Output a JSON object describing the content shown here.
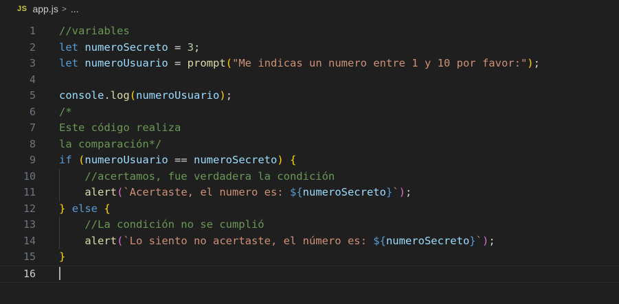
{
  "breadcrumb": {
    "language_badge": "JS",
    "file": "app.js",
    "separator": ">",
    "more": "..."
  },
  "editor": {
    "active_line": 16,
    "lines": [
      {
        "n": "1",
        "tokens": [
          {
            "t": "//variables",
            "c": "cm"
          }
        ]
      },
      {
        "n": "2",
        "tokens": [
          {
            "t": "let",
            "c": "kw"
          },
          {
            "t": " ",
            "c": "op"
          },
          {
            "t": "numeroSecreto",
            "c": "vr"
          },
          {
            "t": " = ",
            "c": "op"
          },
          {
            "t": "3",
            "c": "nm"
          },
          {
            "t": ";",
            "c": "op"
          }
        ]
      },
      {
        "n": "3",
        "tokens": [
          {
            "t": "let",
            "c": "kw"
          },
          {
            "t": " ",
            "c": "op"
          },
          {
            "t": "numeroUsuario",
            "c": "vr"
          },
          {
            "t": " = ",
            "c": "op"
          },
          {
            "t": "prompt",
            "c": "fn"
          },
          {
            "t": "(",
            "c": "b1"
          },
          {
            "t": "\"Me indicas un numero entre 1 y 10 por favor:\"",
            "c": "st"
          },
          {
            "t": ")",
            "c": "b1"
          },
          {
            "t": ";",
            "c": "op"
          }
        ]
      },
      {
        "n": "4",
        "tokens": []
      },
      {
        "n": "5",
        "tokens": [
          {
            "t": "console",
            "c": "vr"
          },
          {
            "t": ".",
            "c": "op"
          },
          {
            "t": "log",
            "c": "fn"
          },
          {
            "t": "(",
            "c": "b1"
          },
          {
            "t": "numeroUsuario",
            "c": "vr"
          },
          {
            "t": ")",
            "c": "b1"
          },
          {
            "t": ";",
            "c": "op"
          }
        ]
      },
      {
        "n": "6",
        "tokens": [
          {
            "t": "/*",
            "c": "cm"
          }
        ]
      },
      {
        "n": "7",
        "tokens": [
          {
            "t": "Este código realiza",
            "c": "cm"
          }
        ]
      },
      {
        "n": "8",
        "tokens": [
          {
            "t": "la comparación*/",
            "c": "cm"
          }
        ]
      },
      {
        "n": "9",
        "tokens": [
          {
            "t": "if",
            "c": "kw"
          },
          {
            "t": " ",
            "c": "op"
          },
          {
            "t": "(",
            "c": "b1"
          },
          {
            "t": "numeroUsuario",
            "c": "vr"
          },
          {
            "t": " == ",
            "c": "op"
          },
          {
            "t": "numeroSecreto",
            "c": "vr"
          },
          {
            "t": ")",
            "c": "b1"
          },
          {
            "t": " ",
            "c": "op"
          },
          {
            "t": "{",
            "c": "b1"
          }
        ]
      },
      {
        "n": "10",
        "indent": true,
        "tokens": [
          {
            "t": "    ",
            "c": "op"
          },
          {
            "t": "//acertamos, fue verdadera la condición",
            "c": "cm"
          }
        ]
      },
      {
        "n": "11",
        "indent": true,
        "tokens": [
          {
            "t": "    ",
            "c": "op"
          },
          {
            "t": "alert",
            "c": "fn"
          },
          {
            "t": "(",
            "c": "b2"
          },
          {
            "t": "`Acertaste, el numero es: ",
            "c": "st"
          },
          {
            "t": "${",
            "c": "tl"
          },
          {
            "t": "numeroSecreto",
            "c": "vr"
          },
          {
            "t": "}",
            "c": "tl"
          },
          {
            "t": "`",
            "c": "st"
          },
          {
            "t": ")",
            "c": "b2"
          },
          {
            "t": ";",
            "c": "op"
          }
        ]
      },
      {
        "n": "12",
        "tokens": [
          {
            "t": "}",
            "c": "b1"
          },
          {
            "t": " ",
            "c": "op"
          },
          {
            "t": "else",
            "c": "kw"
          },
          {
            "t": " ",
            "c": "op"
          },
          {
            "t": "{",
            "c": "b1"
          }
        ]
      },
      {
        "n": "13",
        "indent": true,
        "tokens": [
          {
            "t": "    ",
            "c": "op"
          },
          {
            "t": "//La condición no se cumplió",
            "c": "cm"
          }
        ]
      },
      {
        "n": "14",
        "indent": true,
        "tokens": [
          {
            "t": "    ",
            "c": "op"
          },
          {
            "t": "alert",
            "c": "fn"
          },
          {
            "t": "(",
            "c": "b2"
          },
          {
            "t": "`Lo siento no acertaste, el número es: ",
            "c": "st"
          },
          {
            "t": "${",
            "c": "tl"
          },
          {
            "t": "numeroSecreto",
            "c": "vr"
          },
          {
            "t": "}",
            "c": "tl"
          },
          {
            "t": "`",
            "c": "st"
          },
          {
            "t": ")",
            "c": "b2"
          },
          {
            "t": ";",
            "c": "op"
          }
        ]
      },
      {
        "n": "15",
        "tokens": [
          {
            "t": "}",
            "c": "b1"
          }
        ]
      },
      {
        "n": "16",
        "tokens": []
      }
    ]
  }
}
